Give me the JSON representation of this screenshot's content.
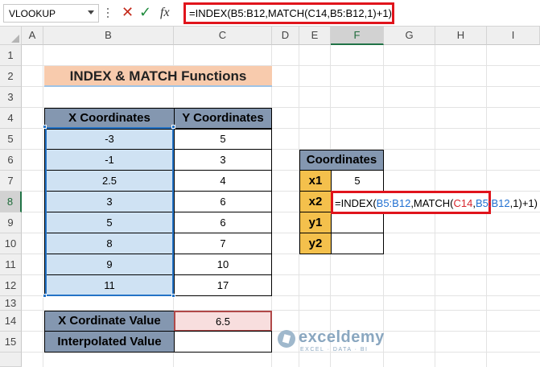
{
  "formula_bar": {
    "name_box": "VLOOKUP",
    "formula": "=INDEX(B5:B12,MATCH(C14,B5:B12,1)+1)"
  },
  "columns": [
    "A",
    "B",
    "C",
    "D",
    "E",
    "F",
    "G",
    "H",
    "I"
  ],
  "rows": [
    "1",
    "2",
    "3",
    "4",
    "5",
    "6",
    "7",
    "8",
    "9",
    "10",
    "11",
    "12",
    "13",
    "14",
    "15"
  ],
  "title": "INDEX & MATCH Functions",
  "table": {
    "headers": [
      "X Coordinates",
      "Y Coordinates"
    ],
    "rows": [
      [
        "-3",
        "5"
      ],
      [
        "-1",
        "3"
      ],
      [
        "2.5",
        "4"
      ],
      [
        "3",
        "6"
      ],
      [
        "5",
        "6"
      ],
      [
        "8",
        "7"
      ],
      [
        "9",
        "10"
      ],
      [
        "11",
        "17"
      ]
    ]
  },
  "results": {
    "x_label": "X Cordinate Value",
    "x_value": "6.5",
    "interp_label": "Interpolated Value",
    "interp_value": ""
  },
  "coordinates": {
    "header": "Coordinates",
    "x1_label": "x1",
    "x1_value": "5",
    "x2_label": "x2",
    "y1_label": "y1",
    "y1_value": "",
    "y2_label": "y2",
    "y2_value": ""
  },
  "cell_formula": {
    "p1": "=INDEX(",
    "r1": "B5:B12",
    "p2": ",MATCH(",
    "r2": "C14",
    "p3": ",",
    "r3": "B5:B12",
    "p4": ",1)+1)"
  },
  "watermark": {
    "name": "exceldemy",
    "tagline": "EXCEL · DATA · BI"
  },
  "colors": {
    "title_fill": "#f8cbad",
    "header_fill": "#8497b0",
    "x_fill": "#cfe2f3",
    "label_fill": "#f4c04c",
    "input_fill": "#f8dede",
    "highlight_border": "#e0141c"
  }
}
